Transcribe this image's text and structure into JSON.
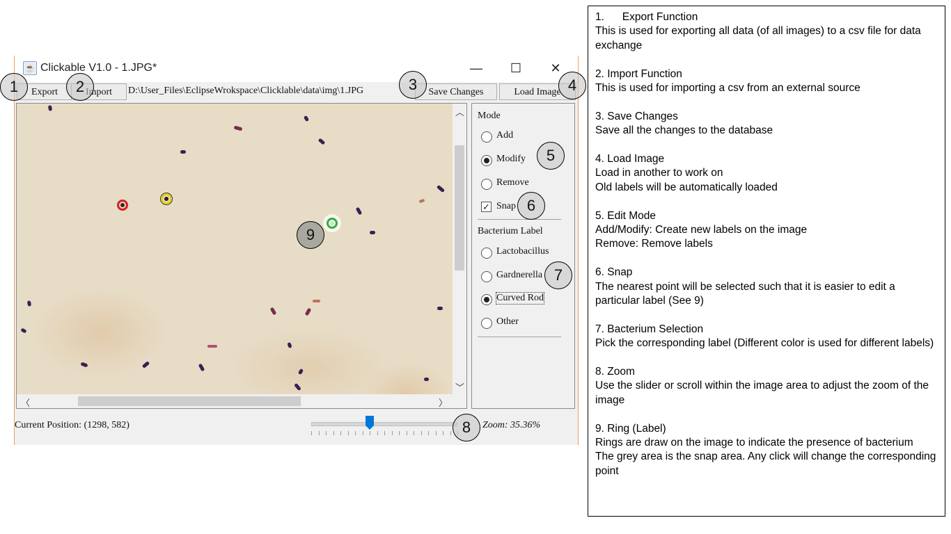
{
  "window": {
    "title": "Clickable V1.0 - 1.JPG*",
    "controls": {
      "minimize": "—",
      "maximize": "☐",
      "close": "✕"
    }
  },
  "toolbar": {
    "export_label": "Export",
    "import_label": "Import",
    "path": "D:\\User_Files\\EclipseWrokspace\\Clicklable\\data\\img\\1.JPG",
    "save_label": "Save Changes",
    "load_label": "Load Image"
  },
  "panel": {
    "mode_title": "Mode",
    "mode_options": [
      "Add",
      "Modify",
      "Remove"
    ],
    "mode_selected": "Modify",
    "snap_label": "Snap",
    "snap_checked": true,
    "bacterium_title": "Bacterium Label",
    "bacterium_options": [
      "Lactobacillus",
      "Gardnerella",
      "Curved Rod",
      "Other"
    ],
    "bacterium_selected": "Curved Rod"
  },
  "status": {
    "position": "Current Position: (1298, 582)",
    "zoom": "Zoom: 35.36%",
    "zoom_slider_fraction": 0.4
  },
  "rings": [
    {
      "color": "#d02020"
    },
    {
      "color": "#e0d020"
    },
    {
      "color": "#30b040"
    }
  ],
  "callouts": [
    "1",
    "2",
    "3",
    "4",
    "5",
    "6",
    "7",
    "8",
    "9"
  ],
  "description": [
    {
      "heading": "1.      Export Function",
      "lines": [
        "This is used for exporting all data (of all images) to a csv file for data exchange"
      ]
    },
    {
      "heading": "2. Import Function",
      "lines": [
        "This is used for importing a csv from an external source"
      ]
    },
    {
      "heading": "3. Save Changes",
      "lines": [
        "Save all the changes to the database"
      ]
    },
    {
      "heading": "4. Load Image",
      "lines": [
        "Load in another to work on",
        "Old labels will be automatically loaded"
      ]
    },
    {
      "heading": "5. Edit Mode",
      "lines": [
        "Add/Modify: Create new labels on the image",
        "Remove: Remove labels"
      ]
    },
    {
      "heading": "6. Snap",
      "lines": [
        "The nearest point will be selected such that it is easier to edit a particular label (See 9)"
      ]
    },
    {
      "heading": "7. Bacterium Selection",
      "lines": [
        "Pick the corresponding label (Different color is used for different labels)"
      ]
    },
    {
      "heading": "8. Zoom",
      "lines": [
        "Use the slider or scroll within the image area to adjust the zoom of the image"
      ]
    },
    {
      "heading": "9. Ring (Label)",
      "lines": [
        "Rings are draw on the image to indicate the presence of bacterium",
        "The grey area is the snap area. Any click will change the corresponding point"
      ]
    }
  ]
}
